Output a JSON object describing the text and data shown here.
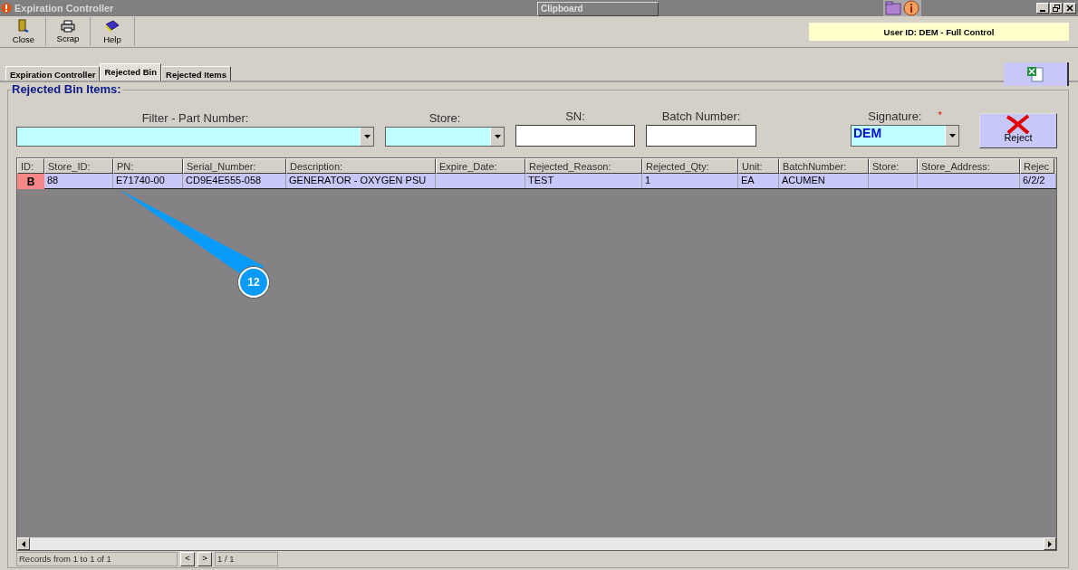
{
  "window": {
    "title": "Expiration Controller",
    "clipboard": "Clipboard"
  },
  "toolbar": [
    {
      "label": "Close",
      "kind": "door"
    },
    {
      "label": "Scrap",
      "kind": "printer"
    },
    {
      "label": "Help",
      "kind": "book"
    }
  ],
  "user_info": "User ID: DEM - Full Control",
  "tabs": [
    {
      "label": "Expiration Controller",
      "selected": false
    },
    {
      "label": "Rejected Bin",
      "selected": true
    },
    {
      "label": "Rejected Items",
      "selected": false
    }
  ],
  "group_title": "Rejected Bin Items:",
  "filters": [
    {
      "label": "Filter - Part Number:",
      "kind": "combo"
    },
    {
      "label": "Store:",
      "kind": "combo"
    },
    {
      "label": "SN:",
      "kind": "text"
    },
    {
      "label": "Batch Number:",
      "kind": "text"
    }
  ],
  "signature": {
    "label": "Signature:",
    "required_mark": "*",
    "value": "DEM"
  },
  "reject_button": "Reject",
  "table": {
    "columns": [
      "ID:",
      "Store_ID:",
      "PN:",
      "Serial_Number:",
      "Description:",
      "Expire_Date:",
      "Rejected_Reason:",
      "Rejected_Qty:",
      "Unit:",
      "BatchNumber:",
      "Store:",
      "Store_Address:",
      "Rejec"
    ],
    "rows": [
      {
        "selected": true,
        "badge": "B",
        "cells": [
          "",
          "88",
          "E71740-00",
          "CD9E4E555-058",
          "GENERATOR - OXYGEN PSU",
          "",
          "TEST",
          "1",
          "EA",
          "ACUMEN",
          "",
          "",
          "6/2/2"
        ]
      }
    ]
  },
  "callout": "12",
  "status": {
    "records": "Records from 1 to 1 of 1",
    "prev": "<",
    "next": ">",
    "page": "1 / 1"
  }
}
